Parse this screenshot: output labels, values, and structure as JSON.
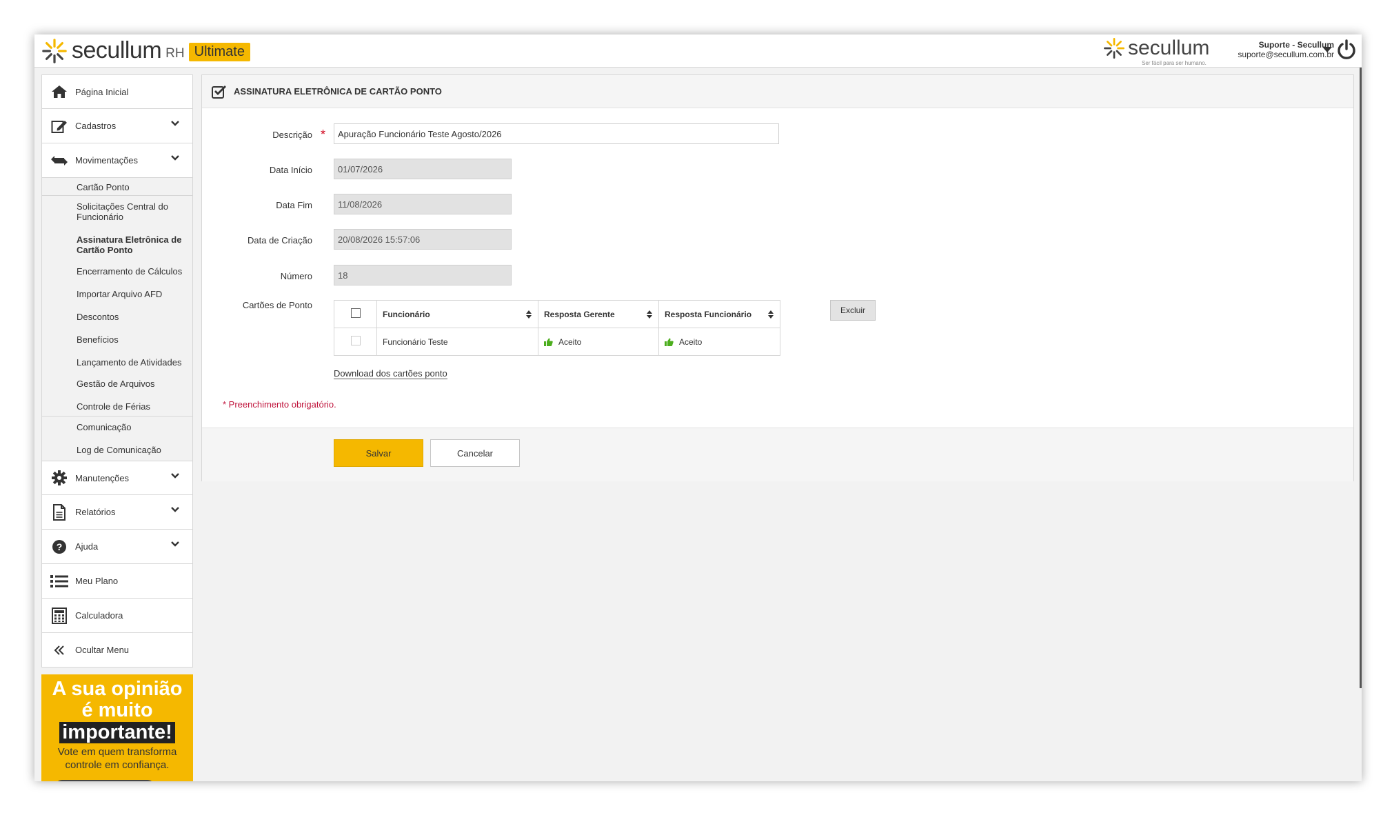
{
  "brand": {
    "name": "secullum",
    "product": "RH",
    "edition": "Ultimate",
    "right_name": "secullum",
    "tagline": "Ser fácil para ser humano."
  },
  "user": {
    "name": "Suporte - Secullum",
    "email": "suporte@secullum.com.br"
  },
  "sidebar": {
    "items": [
      {
        "label": "Página Inicial",
        "icon": "home-icon"
      },
      {
        "label": "Cadastros",
        "icon": "edit-icon"
      },
      {
        "label": "Movimentações",
        "icon": "exchange-icon"
      }
    ],
    "submenu": [
      "Cartão Ponto",
      "Solicitações Central do Funcionário",
      "Assinatura Eletrônica de Cartão Ponto",
      "Encerramento de Cálculos",
      "Importar Arquivo AFD",
      "Descontos",
      "Benefícios",
      "Lançamento de Atividades",
      "Gestão de Arquivos",
      "Controle de Férias",
      "Comunicação",
      "Log de Comunicação"
    ],
    "items_after": [
      {
        "label": "Manutenções",
        "icon": "gear-icon"
      },
      {
        "label": "Relatórios",
        "icon": "document-icon"
      },
      {
        "label": "Ajuda",
        "icon": "help-icon"
      },
      {
        "label": "Meu Plano",
        "icon": "list-icon"
      },
      {
        "label": "Calculadora",
        "icon": "calculator-icon"
      },
      {
        "label": "Ocultar Menu",
        "icon": "double-chevron-left-icon"
      }
    ],
    "promo": {
      "line1": "A sua opinião",
      "line2": "é muito",
      "line3": "importante!",
      "line4": "Vote em quem transforma",
      "line5": "controle em confiança."
    }
  },
  "panel": {
    "title": "ASSINATURA ELETRÔNICA DE CARTÃO PONTO",
    "fields": {
      "descricao_label": "Descrição",
      "descricao_value": "Apuração Funcionário Teste Agosto/2026",
      "data_inicio_label": "Data Início",
      "data_inicio_value": "01/07/2026",
      "data_fim_label": "Data Fim",
      "data_fim_value": "11/08/2026",
      "data_criacao_label": "Data de Criação",
      "data_criacao_value": "20/08/2026 15:57:06",
      "numero_label": "Número",
      "numero_value": "18",
      "cartoes_label": "Cartões de Ponto"
    },
    "required_mark": "*",
    "table": {
      "headers": [
        "Funcionário",
        "Resposta Gerente",
        "Resposta Funcionário"
      ],
      "rows": [
        {
          "funcionario": "Funcionário Teste",
          "gerente": "Aceito",
          "funcionario_resp": "Aceito"
        }
      ]
    },
    "excluir_label": "Excluir",
    "download_label": "Download dos cartões ponto",
    "required_note": "* Preenchimento obrigatório.",
    "save_label": "Salvar",
    "cancel_label": "Cancelar"
  },
  "colors": {
    "accent": "#f5b800",
    "required": "#d0021b",
    "accept": "#4cae1e"
  }
}
